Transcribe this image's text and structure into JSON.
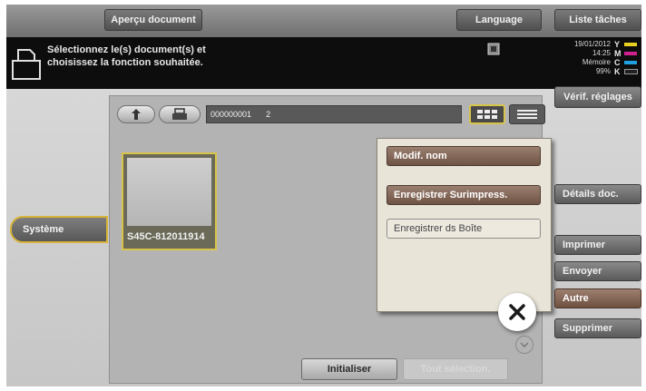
{
  "header": {
    "preview_label": "Aperçu document",
    "language_label": "Language",
    "jobs_label": "Liste tâches"
  },
  "message": {
    "line1": "Sélectionnez le(s) document(s) et",
    "line2": "choisissez la fonction souhaitée."
  },
  "status": {
    "date": "19/01/2012",
    "time": "14:25",
    "memory_label": "Mémoire",
    "memory_value": "99%",
    "toner": [
      {
        "letter": "Y",
        "color": "#e8d020"
      },
      {
        "letter": "M",
        "color": "#d02090"
      },
      {
        "letter": "C",
        "color": "#20a0e0"
      },
      {
        "letter": "K",
        "color": "#202020"
      }
    ]
  },
  "verif_label": "Vérif. réglages",
  "path": {
    "box_number": "000000001",
    "box_count": "2"
  },
  "document": {
    "name": "S45C-812011914"
  },
  "left_tab": "Système",
  "popup": {
    "rename_label": "Modif. nom",
    "overlay_label": "Enregistrer Surimpress.",
    "save_box_label": "Enregistrer ds Boîte"
  },
  "right_menu": {
    "details": "Détails doc.",
    "print": "Imprimer",
    "send": "Envoyer",
    "other": "Autre",
    "delete": "Supprimer"
  },
  "bottom": {
    "reset_label": "Initialiser",
    "select_all_label": "Tout sélection."
  }
}
